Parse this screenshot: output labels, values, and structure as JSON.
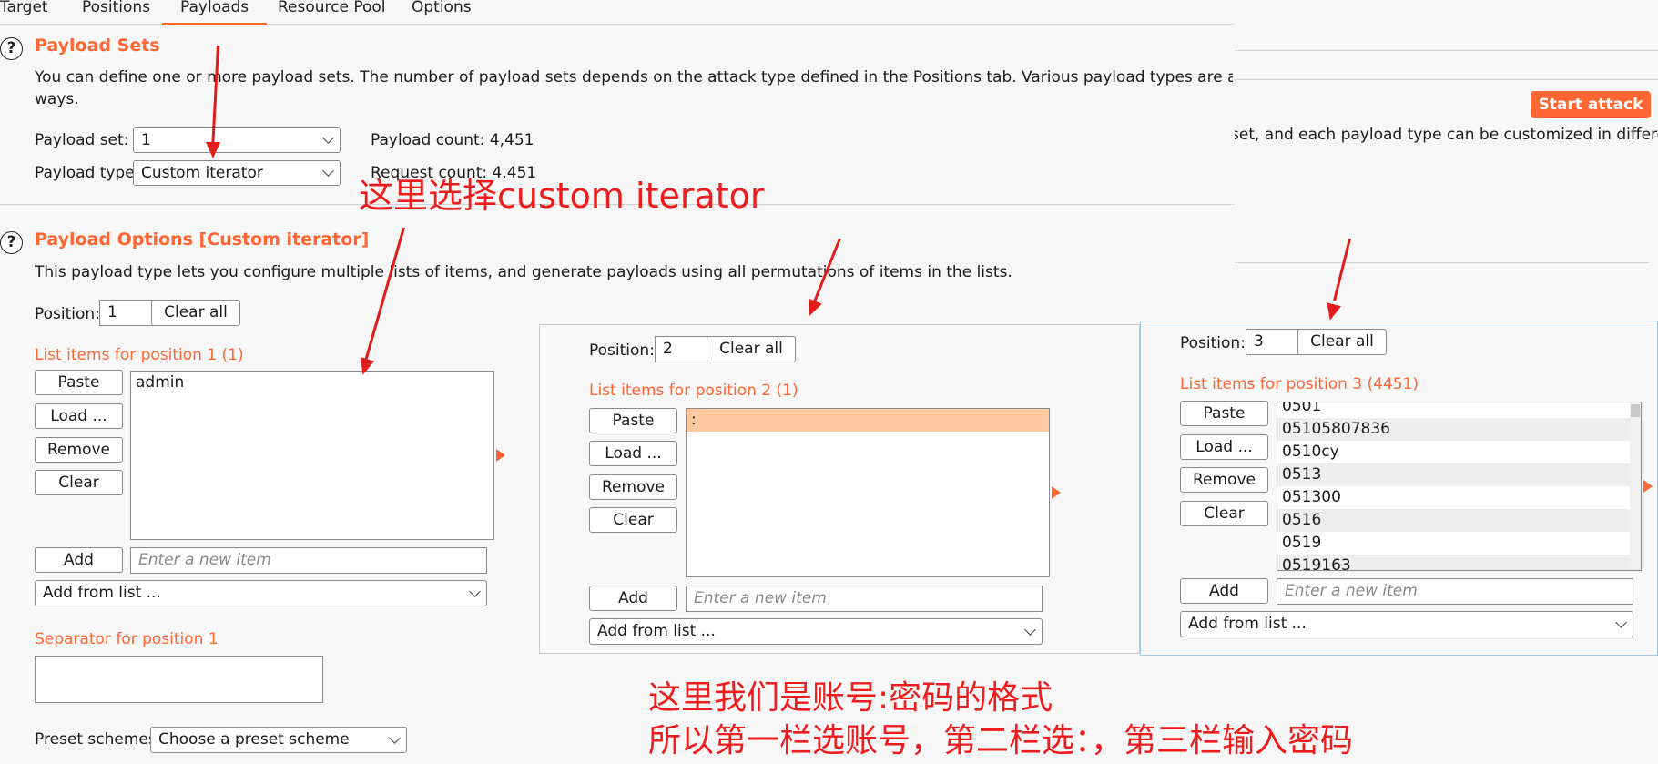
{
  "tabs": [
    "Target",
    "Positions",
    "Payloads",
    "Resource Pool",
    "Options"
  ],
  "active_tab": "Payloads",
  "accent_color": "#ff6633",
  "payload_sets": {
    "title": "Payload Sets",
    "description_line1": "You can define one or more payload sets. The number of payload sets depends on the attack type defined in the Positions tab. Various payload types are available for each p",
    "description_line2": "ways.",
    "bg_description": "set, and each payload type can be customized in different",
    "payload_set_label": "Payload set:",
    "payload_set_value": "1",
    "payload_type_label": "Payload type:",
    "payload_type_value": "Custom iterator",
    "payload_count": "Payload count: 4,451",
    "request_count": "Request count: 4,451"
  },
  "start_attack": "Start attack",
  "payload_options": {
    "title": "Payload Options [Custom iterator]",
    "description": "This payload type lets you configure multiple lists of items, and generate payloads using all permutations of items in the lists.",
    "position_label": "Position:",
    "position_value": "1",
    "clear_all": "Clear all",
    "list_title": "List items for position 1 (1)",
    "paste": "Paste",
    "load": "Load ...",
    "remove": "Remove",
    "clear": "Clear",
    "items": [
      "admin"
    ],
    "add": "Add",
    "add_placeholder": "Enter a new item",
    "add_from_list": "Add from list ...",
    "separator_title": "Separator for position 1",
    "preset_label": "Preset schemes:",
    "preset_value": "Choose a preset scheme"
  },
  "position2": {
    "position_label": "Position:",
    "position_value": "2",
    "clear_all": "Clear all",
    "list_title": "List items for position 2 (1)",
    "paste": "Paste",
    "load": "Load ...",
    "remove": "Remove",
    "clear": "Clear",
    "items": [
      ":"
    ],
    "add": "Add",
    "add_placeholder": "Enter a new item",
    "add_from_list": "Add from list ..."
  },
  "position3": {
    "position_label": "Position:",
    "position_value": "3",
    "clear_all": "Clear all",
    "list_title": "List items for position 3 (4451)",
    "paste": "Paste",
    "load": "Load ...",
    "remove": "Remove",
    "clear": "Clear",
    "items": [
      "0501",
      "05105807836",
      "0510cy",
      "0513",
      "051300",
      "0516",
      "0519",
      "0519163"
    ],
    "add": "Add",
    "add_placeholder": "Enter a new item",
    "add_from_list": "Add from list ..."
  },
  "annotations": {
    "choose_custom": "这里选择custom iterator",
    "format_line1": "这里我们是账号:密码的格式",
    "format_line2": "所以第一栏选账号，第二栏选：，第三栏输入密码"
  }
}
